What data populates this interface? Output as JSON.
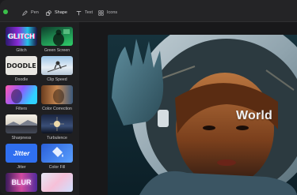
{
  "toolbar": {
    "tools": [
      {
        "label": "Pen",
        "icon": "pen-icon"
      },
      {
        "label": "Shape",
        "icon": "shape-icon"
      },
      {
        "label": "Text",
        "icon": "text-icon"
      },
      {
        "label": "Icons",
        "icon": "icons-icon"
      }
    ],
    "active_tool": "Shape"
  },
  "sidebar": {
    "effects": [
      {
        "label": "Glitch",
        "thumb_text": "GLITCH"
      },
      {
        "label": "Green Screen"
      },
      {
        "label": "Doodle",
        "thumb_text": "DOODLE"
      },
      {
        "label": "Clip Speed"
      },
      {
        "label": "Filters"
      },
      {
        "label": "Color Correction"
      },
      {
        "label": "Sharpness"
      },
      {
        "label": "Turbulence"
      },
      {
        "label": "Jitter",
        "thumb_text": "Jitter"
      },
      {
        "label": "Color Fill"
      },
      {
        "thumb_text": "BLUR"
      },
      {}
    ]
  },
  "canvas": {
    "overlay_text": "World"
  },
  "colors": {
    "accent_green": "#3bbf4a",
    "background": "#1e1e20",
    "jitter_blue": "#2f6ff0"
  }
}
